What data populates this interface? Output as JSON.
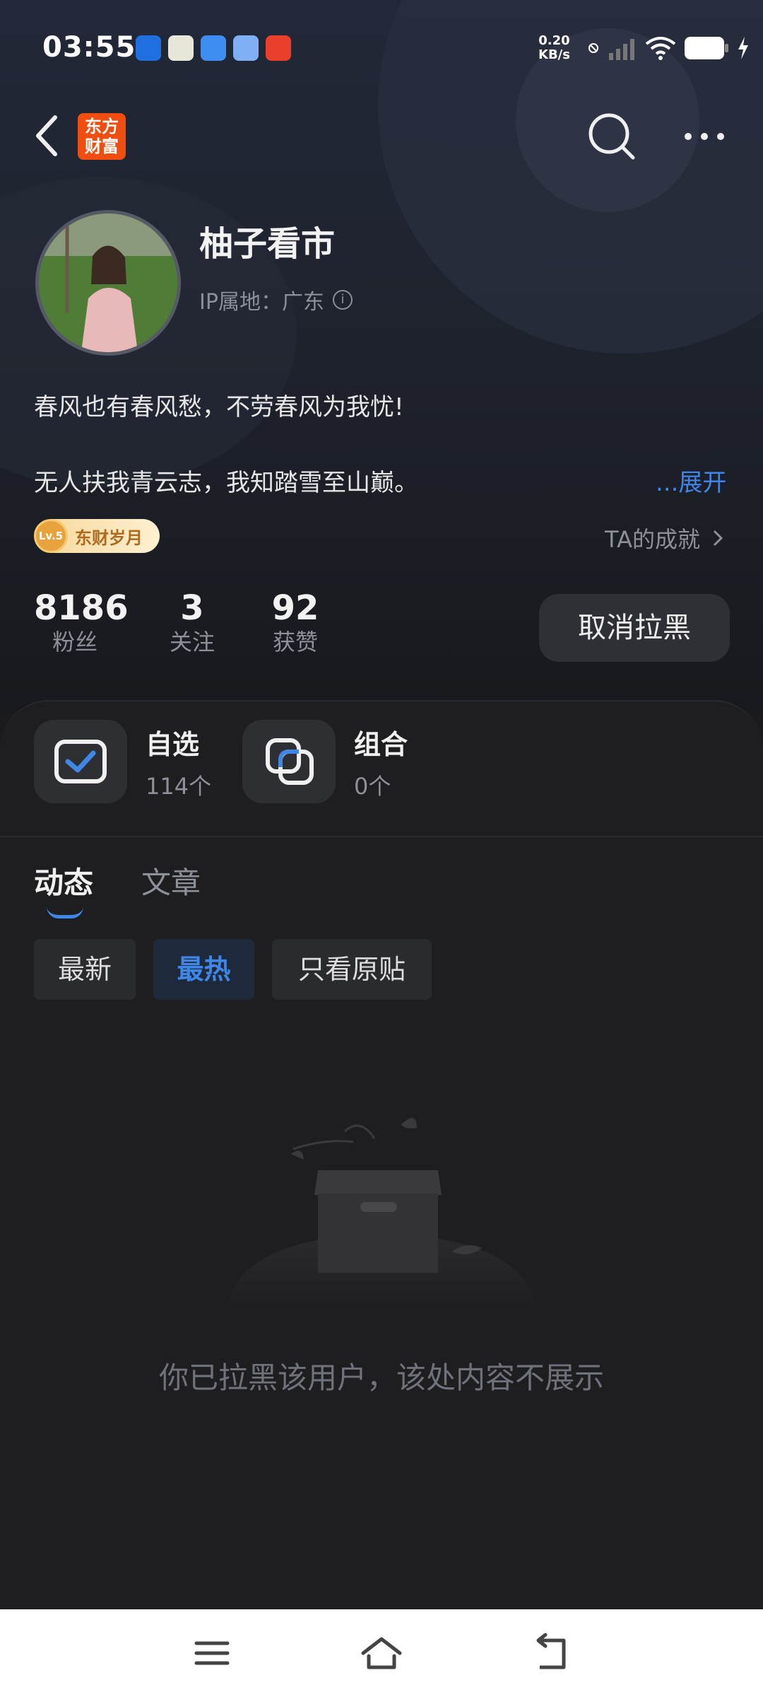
{
  "status_bar": {
    "time": "03:55",
    "net_speed_value": "0.20",
    "net_speed_unit": "KB/s"
  },
  "header": {
    "logo_line1": "东方",
    "logo_line2": "财富"
  },
  "profile": {
    "username": "柚子看市",
    "ip_location": "IP属地：广东",
    "bio_line1": "春风也有春风愁，不劳春风为我忧!",
    "bio_line2": "无人扶我青云志，我知踏雪至山巅。",
    "expand_label": "...展开",
    "badge_level": "Lv.5",
    "badge_label": "东财岁月",
    "achievement_label": "TA的成就",
    "stats": [
      {
        "value": "8186",
        "label": "粉丝"
      },
      {
        "value": "3",
        "label": "关注"
      },
      {
        "value": "92",
        "label": "获赞"
      }
    ],
    "unblock_label": "取消拉黑"
  },
  "tiles": [
    {
      "title": "自选",
      "sub": "114个"
    },
    {
      "title": "组合",
      "sub": "0个"
    }
  ],
  "tabs": [
    "动态",
    "文章"
  ],
  "filters": [
    "最新",
    "最热",
    "只看原贴"
  ],
  "empty_message": "你已拉黑该用户，该处内容不展示",
  "colors": {
    "accent": "#3f86e6",
    "background": "#1b1b1d",
    "logo": "#f04e10"
  }
}
